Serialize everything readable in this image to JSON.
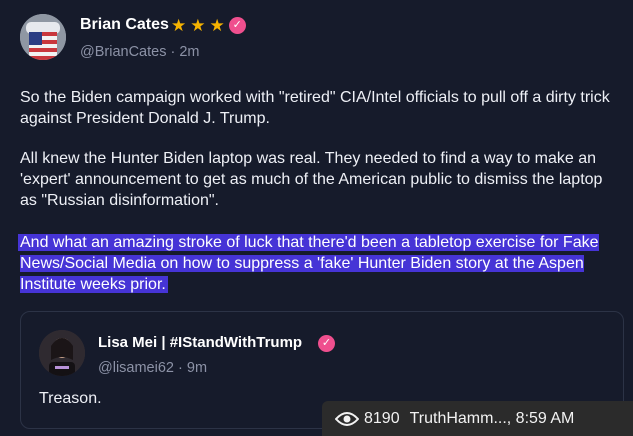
{
  "post": {
    "author_name": "Brian Cates",
    "star_count": 3,
    "handle": "@BrianCates",
    "separator": "·",
    "time": "2m",
    "paragraphs": [
      "So the Biden campaign worked with \"retired\" CIA/Intel officials to pull off a dirty trick against President Donald J. Trump.",
      "All knew the Hunter Biden laptop was real. They needed to find a way to make an 'expert' announcement to get as much of the American public to dismiss the laptop as \"Russian disinformation\".",
      "And what an amazing stroke of luck that there'd been a tabletop exercise for Fake News/Social Media on how to suppress a 'fake' Hunter Biden story at the Aspen Institute weeks prior."
    ]
  },
  "quoted_post": {
    "author_name": "Lisa Mei | #IStandWithTrump",
    "handle": "@lisamei62",
    "separator": "·",
    "time": "9m",
    "text": "Treason."
  },
  "overlay": {
    "view_count": "8190",
    "source_time": "TruthHamm..., 8:59 AM"
  },
  "colors": {
    "background": "#161b2b",
    "highlight": "#4634d6",
    "verified_badge": "#ef4f8e",
    "star": "#f5b301"
  }
}
